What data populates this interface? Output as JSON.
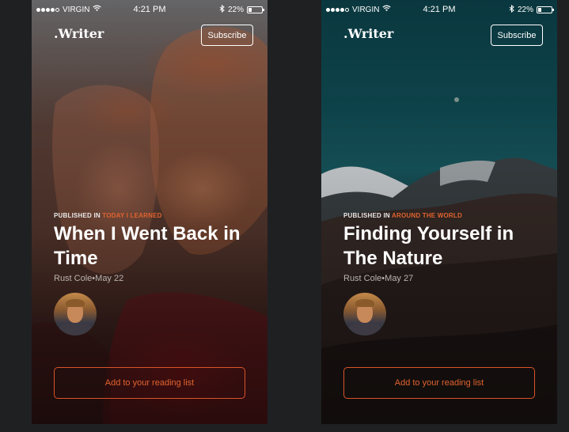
{
  "status_bar": {
    "carrier": "VIRGIN",
    "time": "4:21 PM",
    "battery": "22%",
    "battery_level": 0.22
  },
  "app": {
    "logo": ".Writer",
    "subscribe_label": "Subscribe"
  },
  "cards": [
    {
      "published_prefix": "PUBLISHED IN",
      "category": "TODAY I LEARNED",
      "title": "When I Went Back in Time",
      "author": "Rust Cole",
      "separator": "•",
      "date": "May 22",
      "cta_label": "Add to your reading list"
    },
    {
      "published_prefix": "PUBLISHED IN",
      "category": "AROUND THE WORLD",
      "title": "Finding Yourself in The Nature",
      "author": "Rust Cole",
      "separator": "•",
      "date": "May 27",
      "cta_label": "Add to your reading list"
    }
  ],
  "colors": {
    "accent": "#e0632e",
    "page_bg": "#1f2022",
    "left_bg": "#5a3a30",
    "right_bg": "#0f4a52"
  },
  "icons": {
    "signal": "signal-dots-icon",
    "wifi": "wifi-icon",
    "bluetooth": "bluetooth-icon",
    "battery": "battery-icon"
  }
}
